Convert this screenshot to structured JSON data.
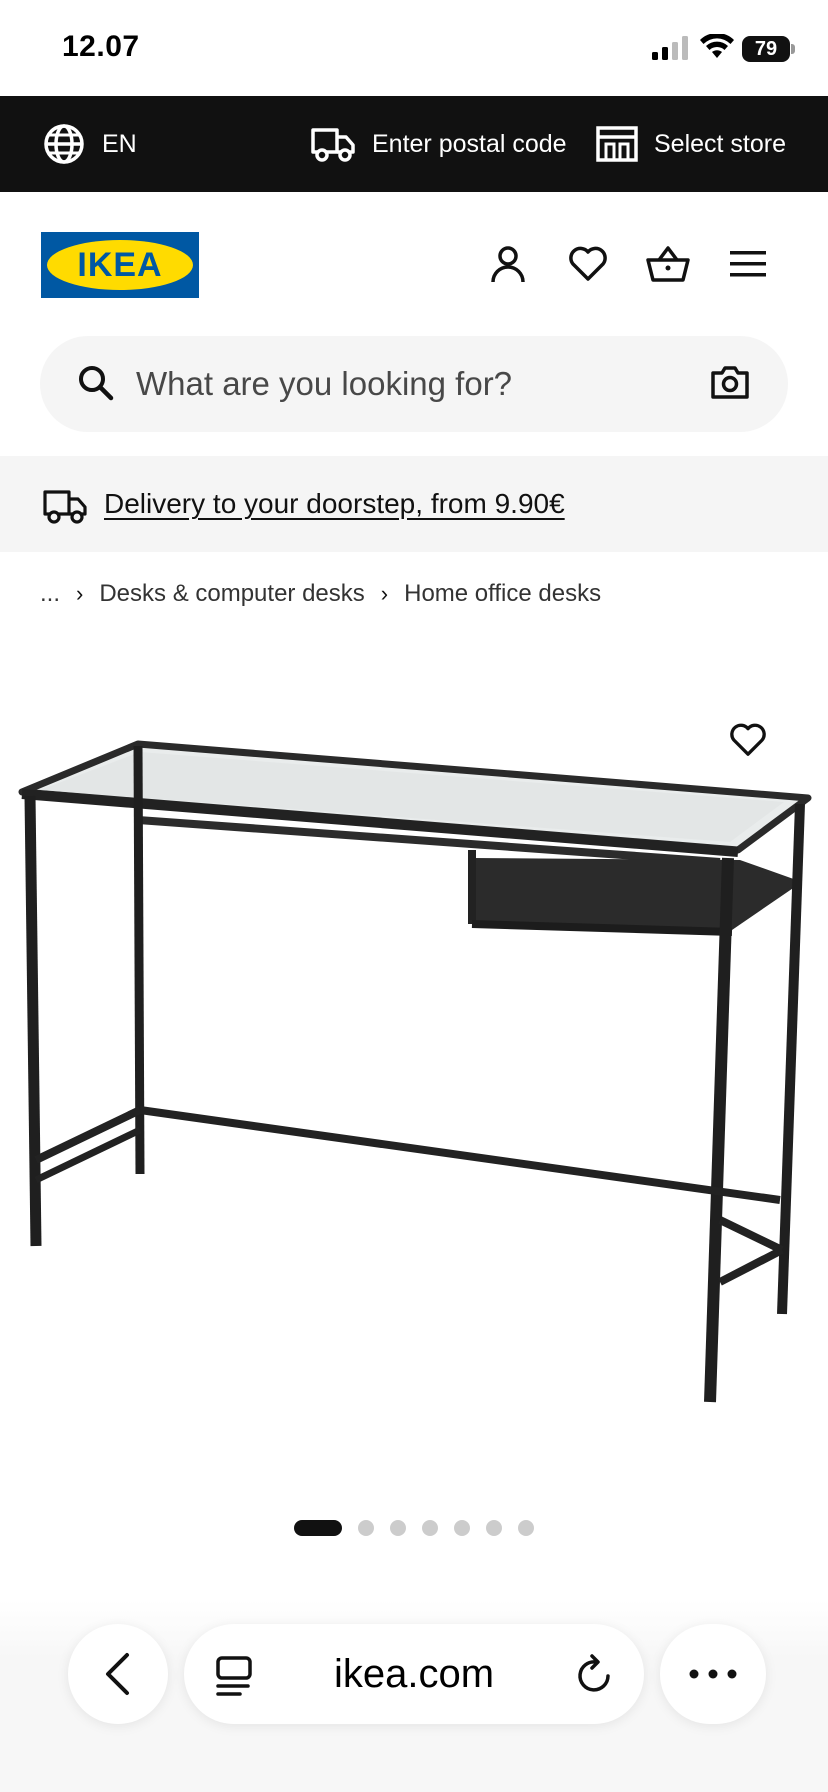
{
  "status": {
    "time": "12.07",
    "battery": "79"
  },
  "util_bar": {
    "language": "EN",
    "postal": "Enter postal code",
    "store": "Select store"
  },
  "header": {
    "logo_text": "IKEA",
    "brand_colors": {
      "blue": "#0058a3",
      "yellow": "#ffdb00"
    }
  },
  "search": {
    "placeholder": "What are you looking for?"
  },
  "delivery_banner": {
    "text": "Delivery to your doorstep, from 9.90€"
  },
  "breadcrumb": {
    "items": [
      "...",
      "Desks & computer desks",
      "Home office desks"
    ]
  },
  "carousel": {
    "total": 7,
    "active": 1
  },
  "browser": {
    "url": "ikea.com"
  },
  "icons": [
    "globe-icon",
    "truck-icon",
    "store-icon",
    "profile-icon",
    "heart-icon",
    "basket-icon",
    "menu-icon",
    "search-icon",
    "camera-icon",
    "back-icon",
    "tabs-icon",
    "reload-icon",
    "more-icon"
  ]
}
